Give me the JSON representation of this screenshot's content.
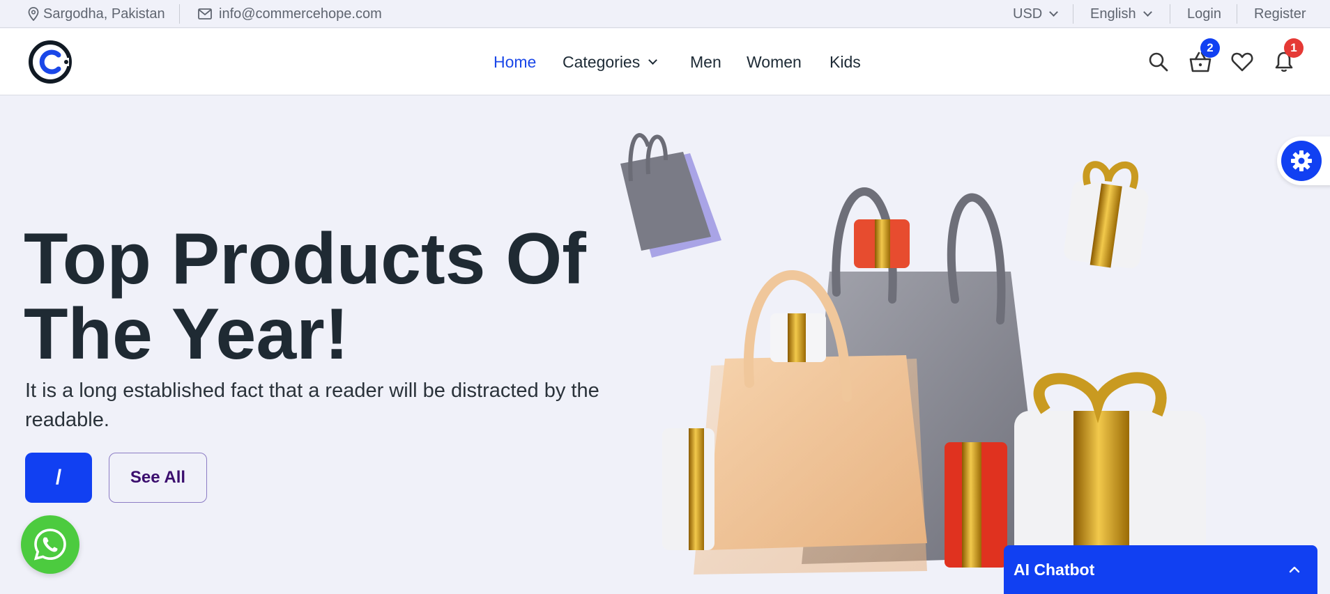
{
  "topbar": {
    "location": "Sargodha, Pakistan",
    "email": "info@commercehope.com",
    "currency": "USD",
    "language": "English",
    "login": "Login",
    "register": "Register"
  },
  "header": {
    "nav": [
      {
        "label": "Home",
        "active": true
      },
      {
        "label": "Categories",
        "dropdown": true
      },
      {
        "label": "Men"
      },
      {
        "label": "Women"
      },
      {
        "label": "Kids"
      }
    ],
    "cart_count": "2",
    "notification_count": "1",
    "icons": [
      "search-icon",
      "basket-icon",
      "heart-icon",
      "bell-icon"
    ]
  },
  "hero": {
    "title_line1": "Top Products Of",
    "title_line2": "The Year!",
    "subtitle": "It is a long established fact that a reader will be distracted by the readable.",
    "primary_button": "/",
    "secondary_button": "See All"
  },
  "chatbot": {
    "label": "AI Chatbot"
  },
  "colors": {
    "accent": "#1140f2",
    "active_nav": "#1a47e8",
    "badge_blue": "#1140f2",
    "badge_red": "#e53935",
    "whatsapp": "#4ccb3f",
    "background": "#f0f1f9"
  }
}
